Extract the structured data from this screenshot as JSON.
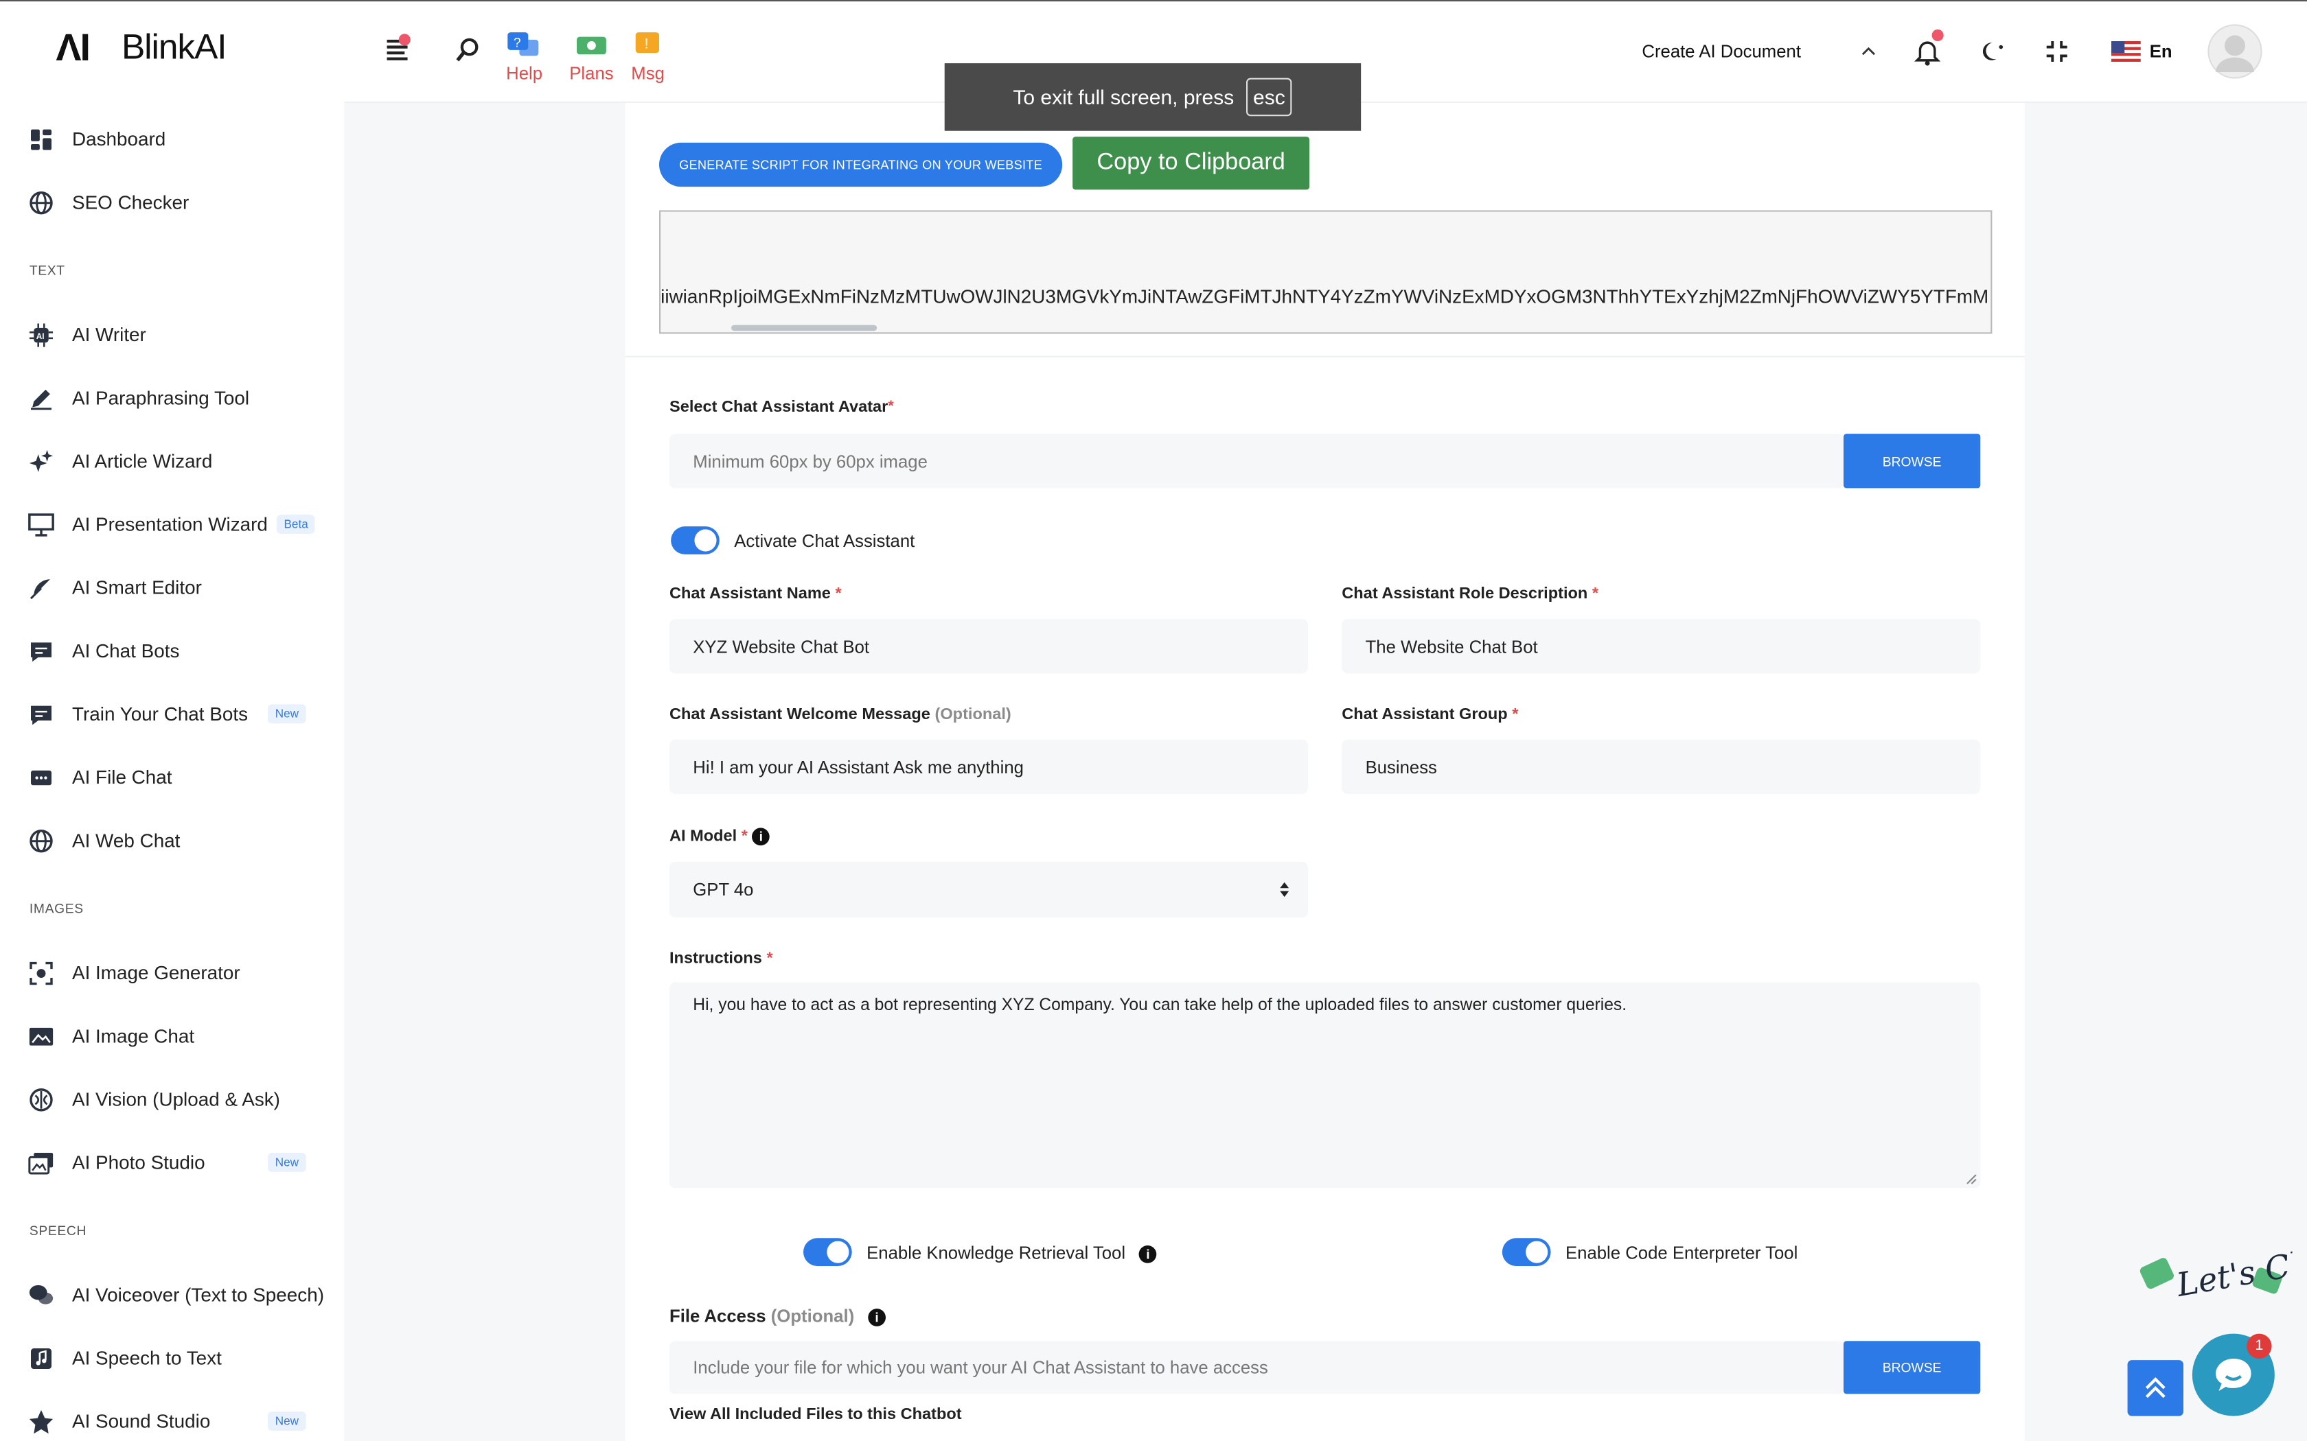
{
  "brand": {
    "mark": "ΛI",
    "name": "BlinkAI"
  },
  "sidebar": {
    "items": [
      {
        "type": "item",
        "label": "Dashboard",
        "icon": "dashboard-icon"
      },
      {
        "type": "item",
        "label": "SEO Checker",
        "icon": "globe-icon"
      },
      {
        "type": "section",
        "label": "TEXT"
      },
      {
        "type": "item",
        "label": "AI Writer",
        "icon": "ai-chip-icon"
      },
      {
        "type": "item",
        "label": "AI Paraphrasing Tool",
        "icon": "pen-icon"
      },
      {
        "type": "item",
        "label": "AI Article Wizard",
        "icon": "sparkle-icon"
      },
      {
        "type": "item",
        "label": "AI Presentation Wizard",
        "icon": "presentation-icon",
        "tag": "Beta"
      },
      {
        "type": "item",
        "label": "AI Smart Editor",
        "icon": "feather-icon"
      },
      {
        "type": "item",
        "label": "AI Chat Bots",
        "icon": "chat-icon"
      },
      {
        "type": "item",
        "label": "Train Your Chat Bots",
        "icon": "chat-icon",
        "tag": "New"
      },
      {
        "type": "item",
        "label": "AI File Chat",
        "icon": "file-chat-icon"
      },
      {
        "type": "item",
        "label": "AI Web Chat",
        "icon": "globe-icon"
      },
      {
        "type": "section",
        "label": "IMAGES"
      },
      {
        "type": "item",
        "label": "AI Image Generator",
        "icon": "image-frame-icon"
      },
      {
        "type": "item",
        "label": "AI Image Chat",
        "icon": "image-icon"
      },
      {
        "type": "item",
        "label": "AI Vision (Upload & Ask)",
        "icon": "brain-icon"
      },
      {
        "type": "item",
        "label": "AI Photo Studio",
        "icon": "photos-icon",
        "tag": "New"
      },
      {
        "type": "section",
        "label": "SPEECH"
      },
      {
        "type": "item",
        "label": "AI Voiceover (Text to Speech)",
        "icon": "speech-icon"
      },
      {
        "type": "item",
        "label": "AI Speech to Text",
        "icon": "music-note-icon"
      },
      {
        "type": "item",
        "label": "AI Sound Studio",
        "icon": "star-icon",
        "tag": "New"
      }
    ]
  },
  "topbar": {
    "help": "Help",
    "plans": "Plans",
    "msg": "Msg",
    "create_doc": "Create AI Document",
    "lang": "En"
  },
  "fullscreen_toast": {
    "text": "To exit full screen, press",
    "key": "esc"
  },
  "main": {
    "generate_btn": "GENERATE SCRIPT FOR INTEGRATING ON YOUR WEBSITE",
    "copy_btn": "Copy to Clipboard",
    "script_text": "iiwianRpIjoiMGExNmFiNzMzMTUwOWJlN2U3MGVkYmJiNTAwZGFiMTJhNTY4YzZmYWViNzExMDYxOGM3NThhYTExYzhjM2ZmNjFhOWViZWY5YTFmM",
    "avatar_label": "Select Chat Assistant Avatar",
    "avatar_placeholder": "Minimum 60px by 60px image",
    "browse": "BROWSE",
    "activate_label": "Activate Chat Assistant",
    "name_label": "Chat Assistant Name",
    "name_value": "XYZ Website Chat Bot",
    "role_label": "Chat Assistant Role Description",
    "role_value": "The Website Chat Bot",
    "welcome_label": "Chat Assistant Welcome Message",
    "optional": "(Optional)",
    "welcome_value": "Hi! I am your AI Assistant Ask me anything",
    "group_label": "Chat Assistant Group",
    "group_value": "Business",
    "model_label": "AI Model",
    "model_value": "GPT 4o",
    "instructions_label": "Instructions",
    "instructions_value": "Hi, you have to act as a bot representing XYZ Company. You can take help of the uploaded files to answer customer queries.",
    "knowledge_label": "Enable Knowledge Retrieval Tool",
    "code_label": "Enable Code Enterpreter Tool",
    "file_access_label": "File Access",
    "file_placeholder": "Include your file for which you want your AI Chat Assistant to have access",
    "view_files": "View All Included Files to this Chatbot"
  },
  "chat_widget": {
    "badge": "1",
    "lets_chat": "Let's Chat"
  },
  "colors": {
    "accent": "#2c79e8",
    "copy_green": "#3f8f4c",
    "required": "#e04b4b"
  }
}
